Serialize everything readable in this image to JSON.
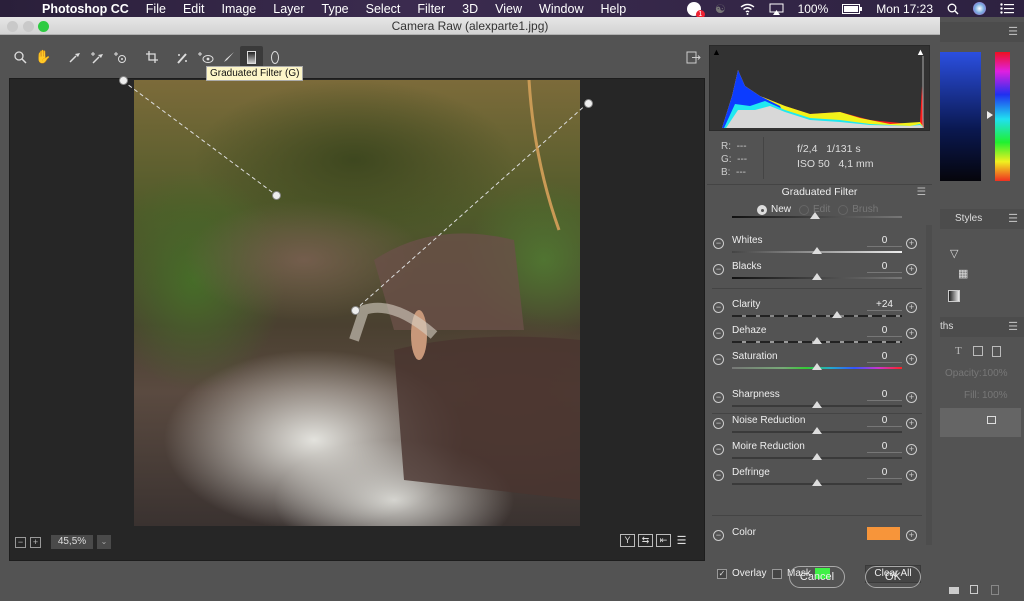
{
  "menubar": {
    "app_name": "Photoshop CC",
    "items": [
      "File",
      "Edit",
      "Image",
      "Layer",
      "Type",
      "Select",
      "Filter",
      "3D",
      "View",
      "Window",
      "Help"
    ],
    "notification_count": "1",
    "battery": "100%",
    "clock": "Mon 17:23"
  },
  "window": {
    "title": "Camera Raw (alexparte1.jpg)"
  },
  "toolbar": {
    "tools": [
      "zoom-tool",
      "hand-tool",
      "white-balance-tool",
      "color-sampler-tool",
      "target-adjustment-tool",
      "crop-tool",
      "spot-removal-tool",
      "red-eye-tool",
      "adjustment-brush-tool",
      "graduated-filter-tool",
      "radial-filter-tool"
    ],
    "active_tool": "graduated-filter-tool",
    "tooltip": "Graduated Filter (G)"
  },
  "preview": {
    "zoom_level": "45,5%"
  },
  "info": {
    "r_label": "R:",
    "g_label": "G:",
    "b_label": "B:",
    "r": "---",
    "g": "---",
    "b": "---",
    "aperture": "f/2,4",
    "shutter": "1/131 s",
    "iso": "ISO 50",
    "focal": "4,1 mm"
  },
  "panel": {
    "title": "Graduated Filter",
    "modes": [
      {
        "label": "New",
        "selected": true
      },
      {
        "label": "Edit",
        "selected": false
      },
      {
        "label": "Brush",
        "selected": false
      }
    ],
    "sliders": [
      {
        "label": "Whites",
        "value": "0",
        "position": 0.5
      },
      {
        "label": "Blacks",
        "value": "0",
        "position": 0.5
      },
      {
        "label": "Clarity",
        "value": "+24",
        "position": 0.62
      },
      {
        "label": "Dehaze",
        "value": "0",
        "position": 0.5
      },
      {
        "label": "Saturation",
        "value": "0",
        "position": 0.5
      },
      {
        "label": "Sharpness",
        "value": "0",
        "position": 0.5
      },
      {
        "label": "Noise Reduction",
        "value": "0",
        "position": 0.5
      },
      {
        "label": "Moire Reduction",
        "value": "0",
        "position": 0.5
      },
      {
        "label": "Defringe",
        "value": "0",
        "position": 0.5
      }
    ],
    "color_label": "Color",
    "color_value": "#f7953a"
  },
  "bottom": {
    "overlay_label": "Overlay",
    "overlay_checked": true,
    "mask_label": "Mask",
    "mask_checked": false,
    "mask_color": "#3ff046",
    "clear_all": "Clear All"
  },
  "dialog_buttons": {
    "cancel": "Cancel",
    "ok": "OK"
  },
  "ps_panels": {
    "styles_tab": "Styles",
    "paths_tab": "ths",
    "opacity_label": "Opacity:",
    "opacity_value": "100%",
    "fill_label": "Fill:",
    "fill_value": "100%"
  }
}
